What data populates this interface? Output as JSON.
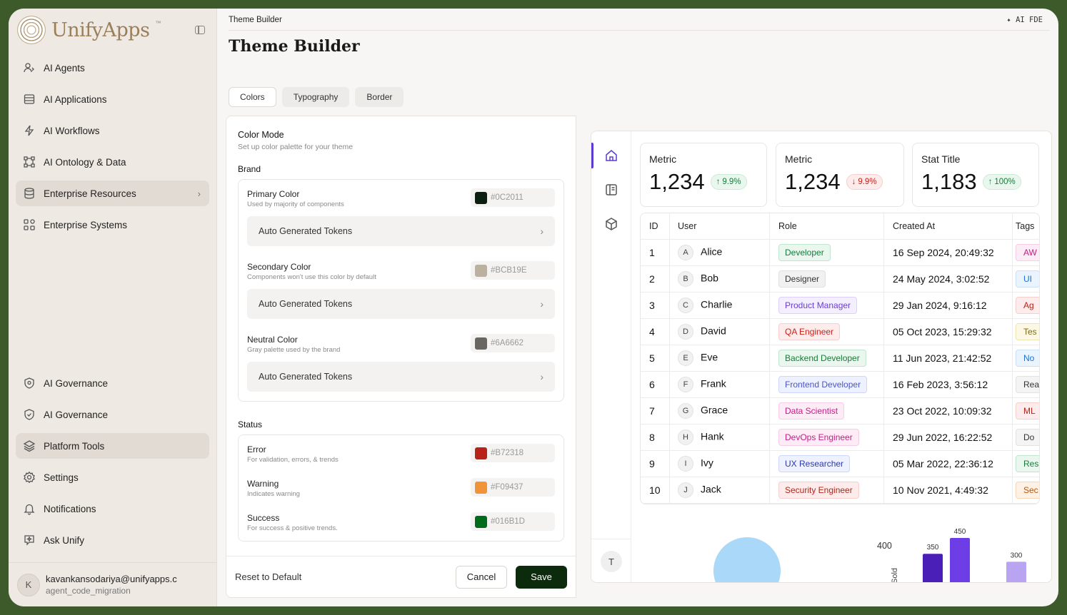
{
  "app": {
    "name": "UnifyApps",
    "tm": "™"
  },
  "sidebar": {
    "items": [
      {
        "label": "AI Agents"
      },
      {
        "label": "AI Applications"
      },
      {
        "label": "AI Workflows"
      },
      {
        "label": "AI Ontology & Data"
      },
      {
        "label": "Enterprise Resources",
        "chevron": "›"
      },
      {
        "label": "Enterprise Systems"
      }
    ],
    "bottom_items": [
      {
        "label": "AI Governance"
      },
      {
        "label": "AI Governance"
      },
      {
        "label": "Platform Tools"
      },
      {
        "label": "Settings"
      },
      {
        "label": "Notifications"
      },
      {
        "label": "Ask Unify"
      }
    ],
    "user": {
      "initial": "K",
      "email": "kavankansodariya@unifyapps.c",
      "org": "agent_code_migration"
    }
  },
  "header": {
    "breadcrumb": "Theme Builder",
    "ai_fde": "✦ AI FDE",
    "title": "Theme Builder"
  },
  "tabs": [
    {
      "label": "Colors"
    },
    {
      "label": "Typography"
    },
    {
      "label": "Border"
    }
  ],
  "color_mode": {
    "title": "Color Mode",
    "subtitle": "Set up color palette for your theme",
    "brand_title": "Brand",
    "brand": [
      {
        "label": "Primary Color",
        "desc": "Used by majority of components",
        "hex": "#0C2011",
        "tokens": "Auto Generated Tokens"
      },
      {
        "label": "Secondary Color",
        "desc": "Components won't use this color by default",
        "hex": "#BCB19E",
        "tokens": "Auto Generated Tokens"
      },
      {
        "label": "Neutral Color",
        "desc": "Gray palette used by the brand",
        "hex": "#6A6662",
        "tokens": "Auto Generated Tokens"
      }
    ],
    "status_title": "Status",
    "status": [
      {
        "label": "Error",
        "desc": "For validation, errors, & trends",
        "hex": "#B72318"
      },
      {
        "label": "Warning",
        "desc": "Indicates warning",
        "hex": "#F09437"
      },
      {
        "label": "Success",
        "desc": "For success & positive trends.",
        "hex": "#016B1D"
      }
    ]
  },
  "footer": {
    "reset": "Reset to Default",
    "cancel": "Cancel",
    "save": "Save"
  },
  "preview": {
    "sidebar_initial": "T",
    "metrics": [
      {
        "label": "Metric",
        "value": "1,234",
        "change": "9.9%",
        "dir": "up"
      },
      {
        "label": "Metric",
        "value": "1,234",
        "change": "9.9%",
        "dir": "down"
      },
      {
        "label": "Stat Title",
        "value": "1,183",
        "change": "100%",
        "dir": "up"
      }
    ],
    "table": {
      "headers": [
        "ID",
        "User",
        "Role",
        "Created At",
        "Tags"
      ],
      "rows": [
        {
          "id": "1",
          "initial": "A",
          "user": "Alice",
          "role": "Developer",
          "created": "16 Sep 2024, 20:49:32",
          "tag": "AW"
        },
        {
          "id": "2",
          "initial": "B",
          "user": "Bob",
          "role": "Designer",
          "created": "24 May 2024, 3:02:52",
          "tag": "UI"
        },
        {
          "id": "3",
          "initial": "C",
          "user": "Charlie",
          "role": "Product Manager",
          "created": "29 Jan 2024, 9:16:12",
          "tag": "Ag"
        },
        {
          "id": "4",
          "initial": "D",
          "user": "David",
          "role": "QA Engineer",
          "created": "05 Oct 2023, 15:29:32",
          "tag": "Tes"
        },
        {
          "id": "5",
          "initial": "E",
          "user": "Eve",
          "role": "Backend Developer",
          "created": "11 Jun 2023, 21:42:52",
          "tag": "No"
        },
        {
          "id": "6",
          "initial": "F",
          "user": "Frank",
          "role": "Frontend Developer",
          "created": "16 Feb 2023, 3:56:12",
          "tag": "Rea"
        },
        {
          "id": "7",
          "initial": "G",
          "user": "Grace",
          "role": "Data Scientist",
          "created": "23 Oct 2022, 10:09:32",
          "tag": "ML"
        },
        {
          "id": "8",
          "initial": "H",
          "user": "Hank",
          "role": "DevOps Engineer",
          "created": "29 Jun 2022, 16:22:52",
          "tag": "Do"
        },
        {
          "id": "9",
          "initial": "I",
          "user": "Ivy",
          "role": "UX Researcher",
          "created": "05 Mar 2022, 22:36:12",
          "tag": "Res"
        },
        {
          "id": "10",
          "initial": "J",
          "user": "Jack",
          "role": "Security Engineer",
          "created": "10 Nov 2021, 4:49:32",
          "tag": "Sec"
        }
      ]
    }
  },
  "chart_data": {
    "type": "bar",
    "ylabel": "Sold",
    "tick_labels": [
      "400"
    ],
    "values": [
      350,
      450,
      300
    ],
    "data_labels": [
      "350",
      "450",
      "300"
    ],
    "colors": [
      "#4a1fb8",
      "#6d3ee6",
      "#b9a4f2"
    ]
  }
}
